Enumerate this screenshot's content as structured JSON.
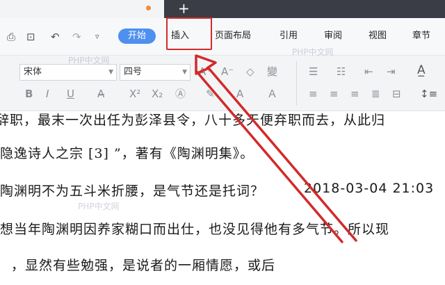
{
  "tabbar": {
    "new_tab": "+"
  },
  "menubar": {
    "start": "开始",
    "items": [
      "插入",
      "页面布局",
      "引用",
      "审阅",
      "视图",
      "章节"
    ]
  },
  "ribbon": {
    "font_name": "宋体",
    "font_size": "四号"
  },
  "document": {
    "lines": [
      "辞职，最末一次出任为彭泽县令，八十多天便弃职而去，从此归",
      "隐逸诗人之宗 [3] ”，著有《陶渊明集》。",
      "陶渊明不为五斗米折腰，是气节还是托词？",
      "想当年陶渊明因养家糊口而出仕，也没见得他有多气节。所以现",
      "，显然有些勉强，是说者的一厢情愿，或后"
    ],
    "timestamp": "2018-03-04 21:03"
  },
  "watermark": "PHP中文网",
  "annotation": {
    "color": "#d22a2a"
  }
}
